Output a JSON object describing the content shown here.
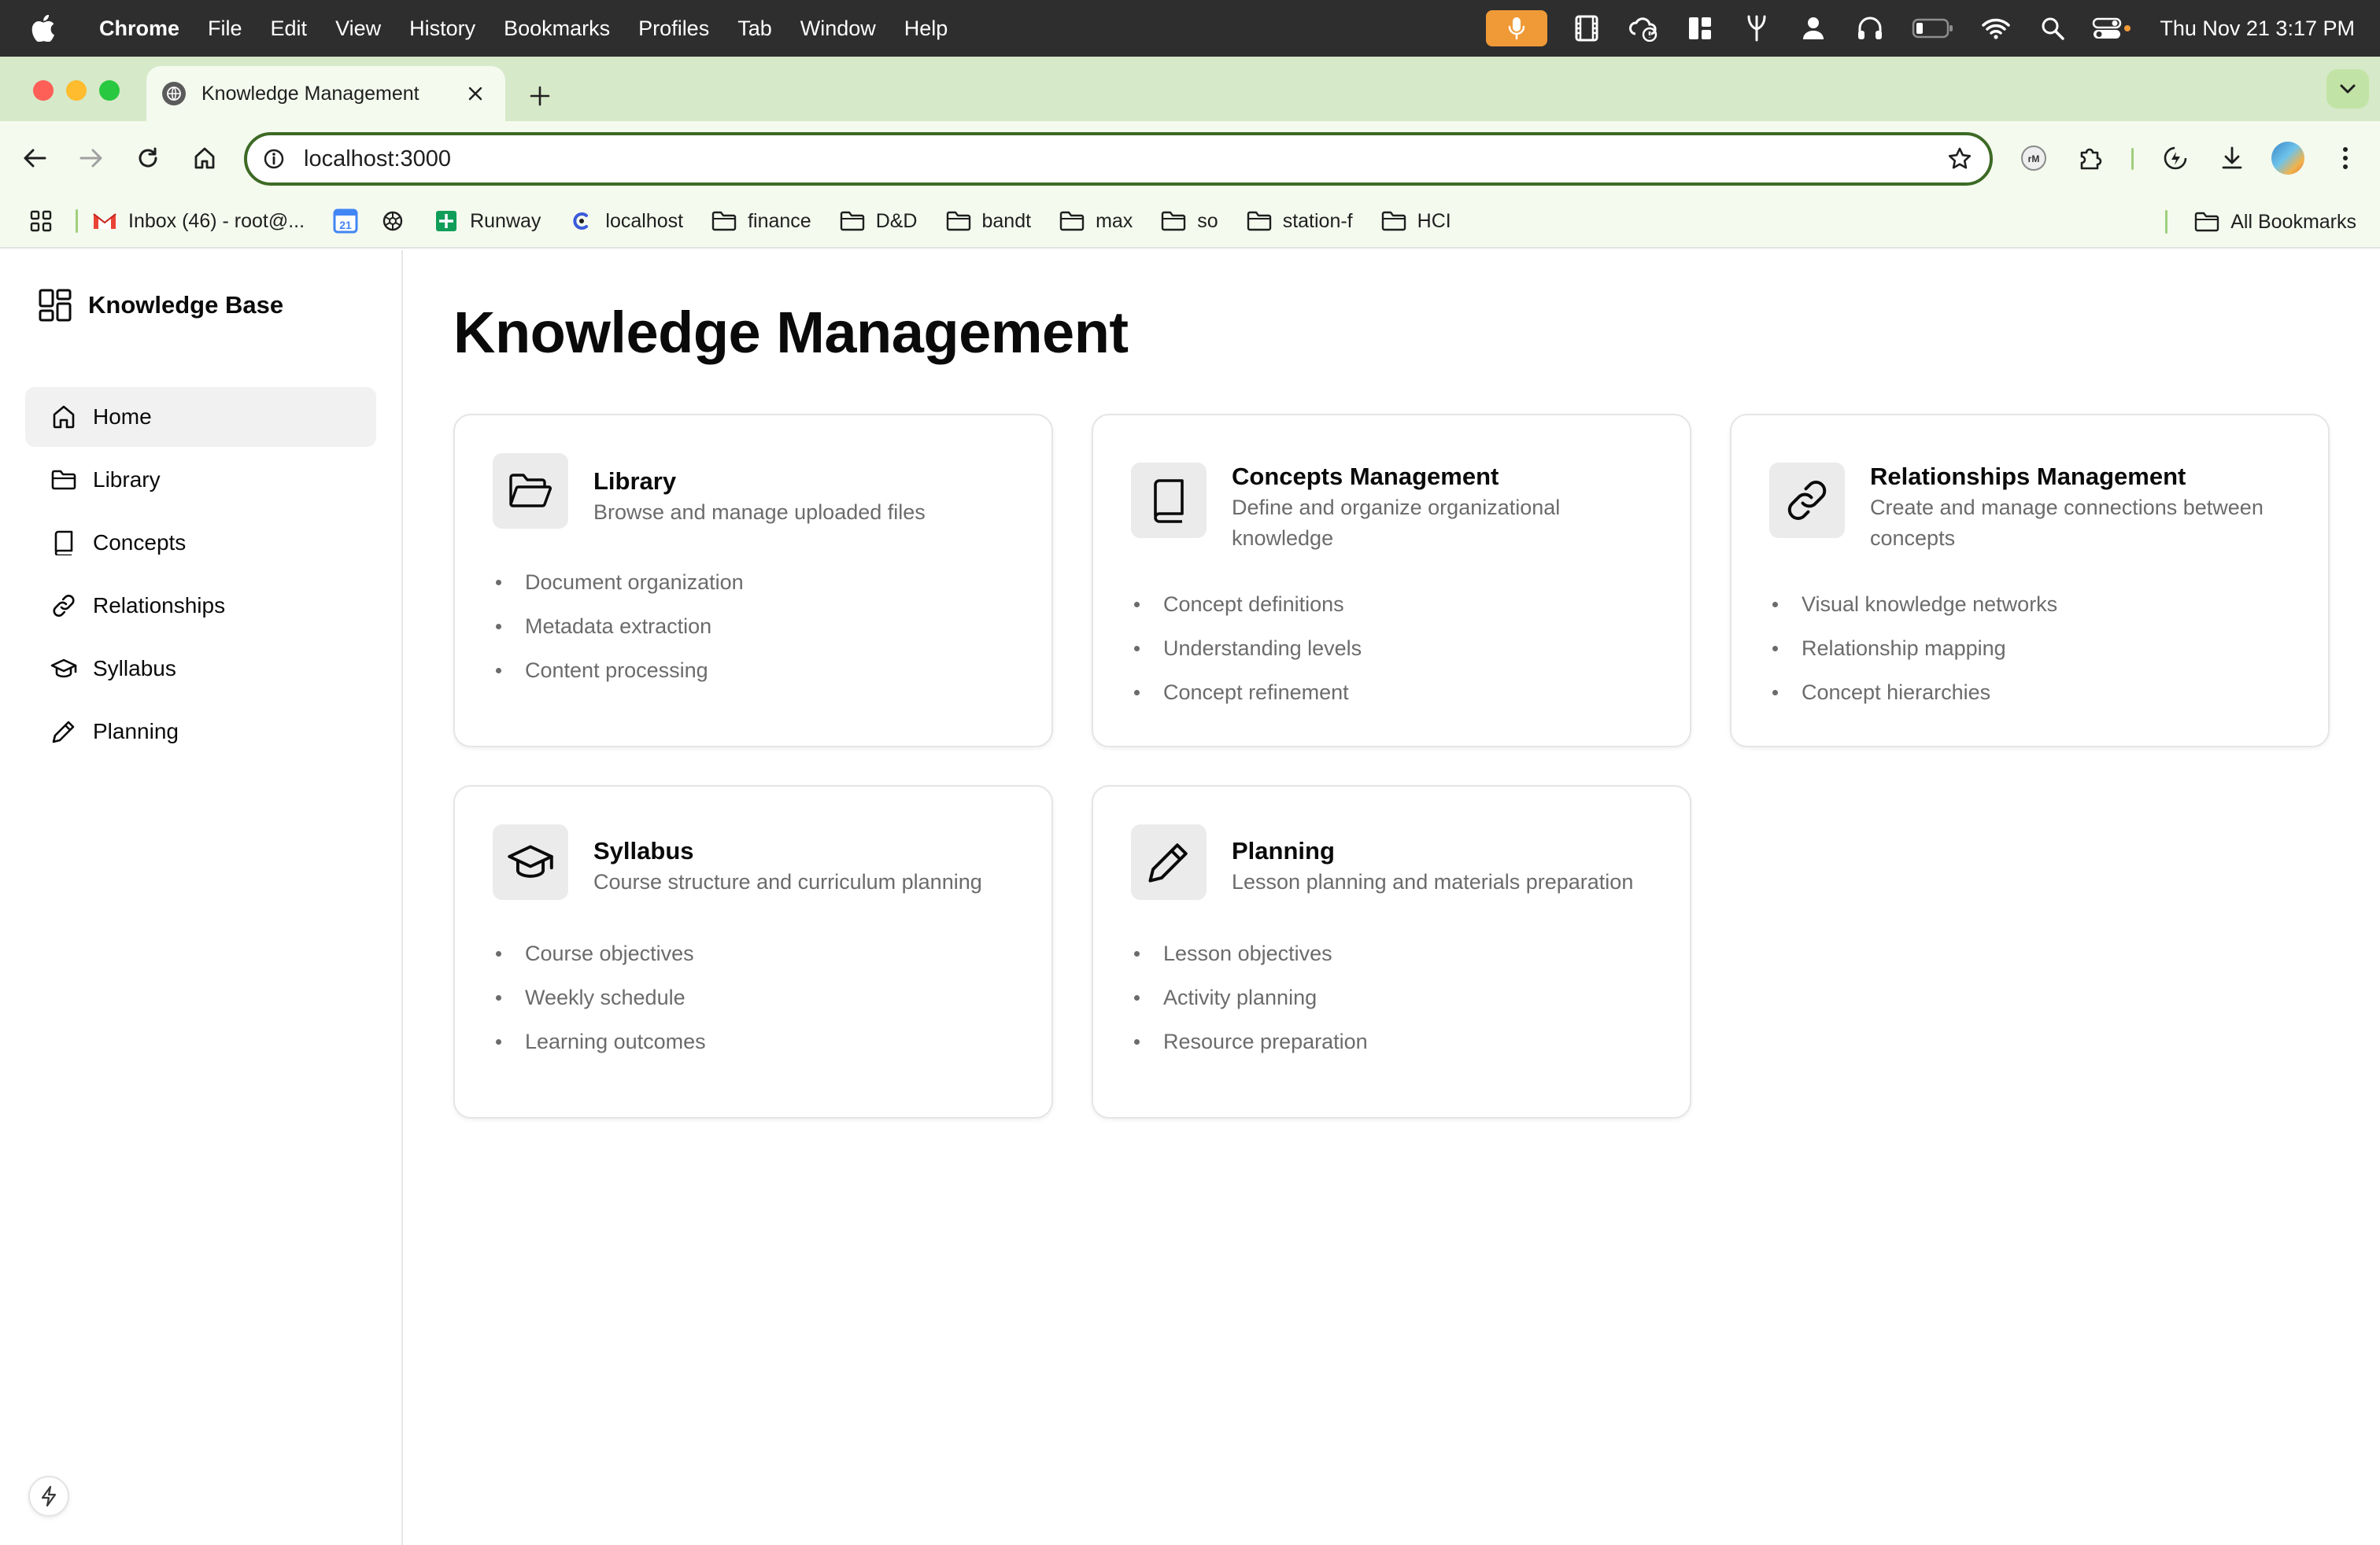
{
  "menubar": {
    "app_name": "Chrome",
    "menus": [
      "File",
      "Edit",
      "View",
      "History",
      "Bookmarks",
      "Profiles",
      "Tab",
      "Window",
      "Help"
    ],
    "clock": "Thu Nov 21  3:17 PM",
    "mic_color": "#f09a37"
  },
  "browser": {
    "tab_title": "Knowledge Management",
    "url": "localhost:3000",
    "accent_color": "#d6e9c8",
    "bookmarks": [
      {
        "label": "Inbox (46) - root@...",
        "icon": "gmail-icon"
      },
      {
        "label": "",
        "icon": "calendar-icon"
      },
      {
        "label": "",
        "icon": "openai-icon"
      },
      {
        "label": "Runway",
        "icon": "sheets-icon"
      },
      {
        "label": "localhost",
        "icon": "local-icon"
      },
      {
        "label": "finance",
        "icon": "folder-icon"
      },
      {
        "label": "D&D",
        "icon": "folder-icon"
      },
      {
        "label": "bandt",
        "icon": "folder-icon"
      },
      {
        "label": "max",
        "icon": "folder-icon"
      },
      {
        "label": "so",
        "icon": "folder-icon"
      },
      {
        "label": "station-f",
        "icon": "folder-icon"
      },
      {
        "label": "HCI",
        "icon": "folder-icon"
      }
    ],
    "calendar_day": "21",
    "all_bookmarks": "All Bookmarks"
  },
  "sidebar": {
    "brand": "Knowledge Base",
    "items": [
      {
        "label": "Home",
        "icon": "home-icon",
        "active": true
      },
      {
        "label": "Library",
        "icon": "folder-icon"
      },
      {
        "label": "Concepts",
        "icon": "book-icon"
      },
      {
        "label": "Relationships",
        "icon": "link-icon"
      },
      {
        "label": "Syllabus",
        "icon": "graduation-cap-icon"
      },
      {
        "label": "Planning",
        "icon": "pencil-icon"
      }
    ]
  },
  "main": {
    "title": "Knowledge Management",
    "cards": [
      {
        "title": "Library",
        "description": "Browse and manage uploaded files",
        "icon": "folder-open-icon",
        "features": [
          "Document organization",
          "Metadata extraction",
          "Content processing"
        ]
      },
      {
        "title": "Concepts Management",
        "description": "Define and organize organizational knowledge",
        "icon": "book-icon",
        "features": [
          "Concept definitions",
          "Understanding levels",
          "Concept refinement"
        ]
      },
      {
        "title": "Relationships Management",
        "description": "Create and manage connections between concepts",
        "icon": "link-icon",
        "features": [
          "Visual knowledge networks",
          "Relationship mapping",
          "Concept hierarchies"
        ]
      },
      {
        "title": "Syllabus",
        "description": "Course structure and curriculum planning",
        "icon": "graduation-cap-icon",
        "features": [
          "Course objectives",
          "Weekly schedule",
          "Learning outcomes"
        ]
      },
      {
        "title": "Planning",
        "description": "Lesson planning and materials preparation",
        "icon": "pencil-icon",
        "features": [
          "Lesson objectives",
          "Activity planning",
          "Resource preparation"
        ]
      }
    ]
  }
}
